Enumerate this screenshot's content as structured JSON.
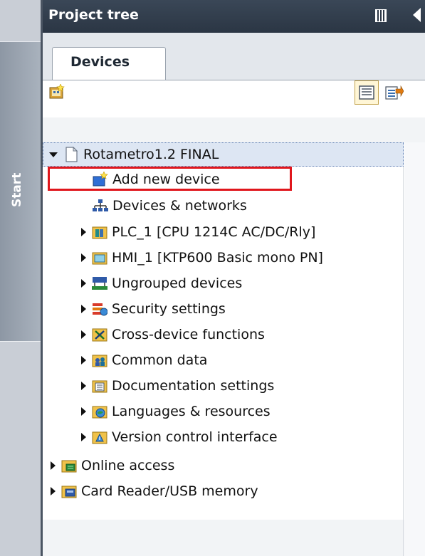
{
  "sidebar": {
    "start_label": "Start"
  },
  "panel": {
    "title": "Project tree"
  },
  "tabs": [
    {
      "label": "Devices"
    }
  ],
  "tree": {
    "root": {
      "label": "Rotametro1.2 FINAL"
    },
    "children": [
      {
        "label": "Add new device",
        "icon": "add-device-icon"
      },
      {
        "label": "Devices & networks",
        "icon": "network-icon"
      },
      {
        "label": "PLC_1 [CPU 1214C AC/DC/Rly]",
        "icon": "plc-icon"
      },
      {
        "label": "HMI_1 [KTP600 Basic mono PN]",
        "icon": "hmi-icon"
      },
      {
        "label": "Ungrouped devices",
        "icon": "ungrouped-devices-icon"
      },
      {
        "label": "Security settings",
        "icon": "security-icon"
      },
      {
        "label": "Cross-device functions",
        "icon": "cross-device-icon"
      },
      {
        "label": "Common data",
        "icon": "common-data-icon"
      },
      {
        "label": "Documentation settings",
        "icon": "documentation-icon"
      },
      {
        "label": "Languages & resources",
        "icon": "languages-icon"
      },
      {
        "label": "Version control interface",
        "icon": "version-control-icon"
      }
    ],
    "top_level": [
      {
        "label": "Online access",
        "icon": "online-access-icon"
      },
      {
        "label": "Card Reader/USB memory",
        "icon": "card-reader-icon"
      }
    ]
  },
  "colors": {
    "highlight": "#e0161c",
    "title_bar": "#2b3644",
    "selection": "#dde6f3"
  }
}
